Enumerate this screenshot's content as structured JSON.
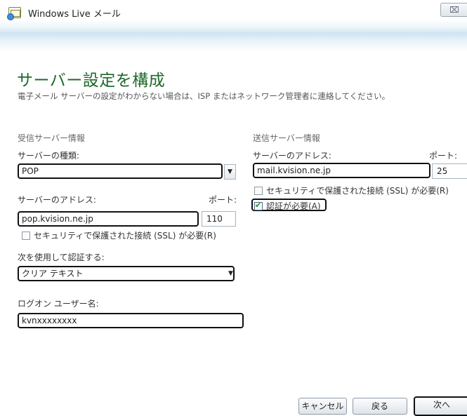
{
  "window": {
    "title": "Windows Live メール",
    "close_label": "⌧"
  },
  "page": {
    "title": "サーバー設定を構成",
    "subtitle": "電子メール サーバーの設定がわからない場合は、ISP またはネットワーク管理者に連絡してください。"
  },
  "incoming": {
    "section_title": "受信サーバー情報",
    "server_type_label": "サーバーの種類:",
    "server_type_value": "POP",
    "address_label": "サーバーのアドレス:",
    "port_label": "ポート:",
    "address_value": "pop.kvision.ne.jp",
    "port_value": "110",
    "ssl_label": "セキュリティで保護された接続 (SSL) が必要(R)",
    "ssl_checked": false,
    "auth_label": "次を使用して認証する:",
    "auth_value": "クリア テキスト",
    "logon_label": "ログオン ユーザー名:",
    "logon_value": "kvnxxxxxxxx"
  },
  "outgoing": {
    "section_title": "送信サーバー情報",
    "address_label": "サーバーのアドレス:",
    "port_label": "ポート:",
    "address_value": "mail.kvision.ne.jp",
    "port_value": "25",
    "ssl_label": "セキュリティで保護された接続 (SSL) が必要(R)",
    "ssl_checked": false,
    "auth_required_label": "認証が必要(A)",
    "auth_required_checked": true
  },
  "buttons": {
    "cancel": "キャンセル",
    "back": "戻る",
    "next": "次へ"
  }
}
